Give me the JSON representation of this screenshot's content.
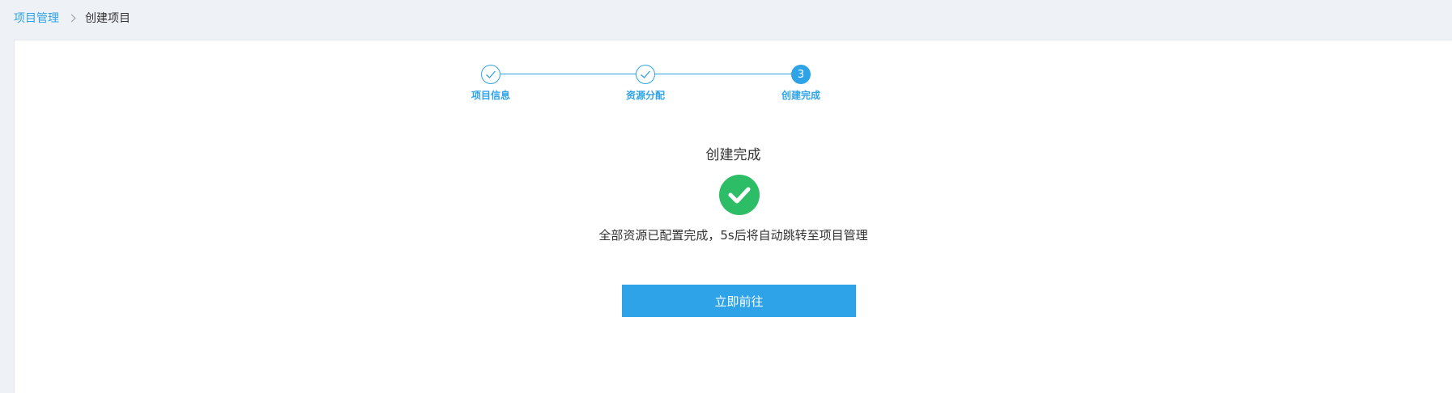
{
  "breadcrumb": {
    "parent": "项目管理",
    "current": "创建项目"
  },
  "steps": [
    {
      "label": "项目信息",
      "status": "done"
    },
    {
      "label": "资源分配",
      "status": "done"
    },
    {
      "label": "创建完成",
      "status": "active",
      "number": "3"
    }
  ],
  "result": {
    "title": "创建完成",
    "icon": "check-circle-icon",
    "message": "全部资源已配置完成，5s后将自动跳转至项目管理",
    "button_label": "立即前往"
  },
  "colors": {
    "accent": "#2ea3e8",
    "success": "#2ebd67",
    "background": "#eef1f5"
  }
}
